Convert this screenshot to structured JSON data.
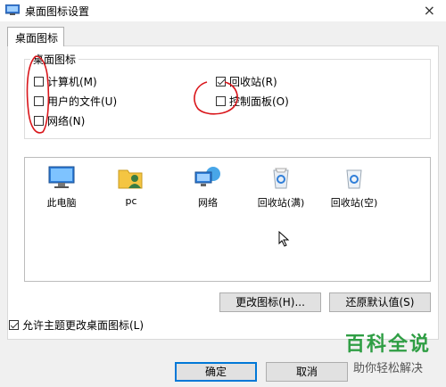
{
  "window": {
    "title": "桌面图标设置"
  },
  "tabs": [
    {
      "label": "桌面图标"
    }
  ],
  "group": {
    "label": "桌面图标",
    "checkboxes": [
      {
        "label": "计算机(M)",
        "checked": false
      },
      {
        "label": "回收站(R)",
        "checked": true
      },
      {
        "label": "用户的文件(U)",
        "checked": false
      },
      {
        "label": "控制面板(O)",
        "checked": false
      },
      {
        "label": "网络(N)",
        "checked": false
      }
    ]
  },
  "icons": [
    {
      "label": "此电脑",
      "icon": "computer-icon"
    },
    {
      "label": "pc",
      "icon": "user-folder-icon"
    },
    {
      "label": "网络",
      "icon": "network-icon"
    },
    {
      "label": "回收站(满)",
      "icon": "recycle-bin-full-icon"
    },
    {
      "label": "回收站(空)",
      "icon": "recycle-bin-empty-icon"
    }
  ],
  "buttons": {
    "change_icon": "更改图标(H)...",
    "restore_default": "还原默认值(S)",
    "ok": "确定",
    "cancel": "取消"
  },
  "allow_themes": {
    "label": "允许主题更改桌面图标(L)",
    "checked": true
  },
  "watermark": {
    "line1": "百科全说",
    "line2": "助你轻松解决"
  },
  "colors": {
    "accent": "#0078d7",
    "annotation": "#d9161b",
    "watermark": "#2f9e44"
  }
}
